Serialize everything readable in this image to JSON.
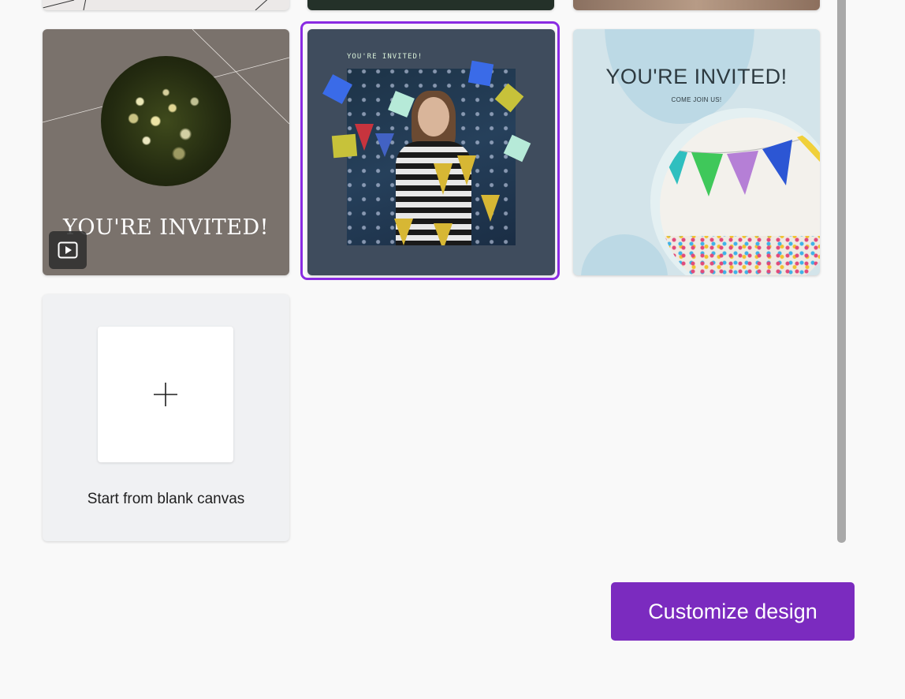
{
  "templates": [
    {
      "id": "card-1",
      "title": "YOU'RE INVITED!",
      "has_video": true,
      "video_icon": "play-video-icon"
    },
    {
      "id": "card-2",
      "title": "YOU'RE INVITED!",
      "selected": true
    },
    {
      "id": "card-3",
      "title": "YOU'RE INVITED!",
      "subtitle": "COME JOIN US!"
    }
  ],
  "blank_canvas": {
    "label": "Start from blank canvas",
    "icon": "plus-icon"
  },
  "actions": {
    "customize_label": "Customize design"
  },
  "colors": {
    "accent": "#7b2bbf",
    "selected_border": "#8a2be2",
    "background": "#f9f9f9"
  }
}
